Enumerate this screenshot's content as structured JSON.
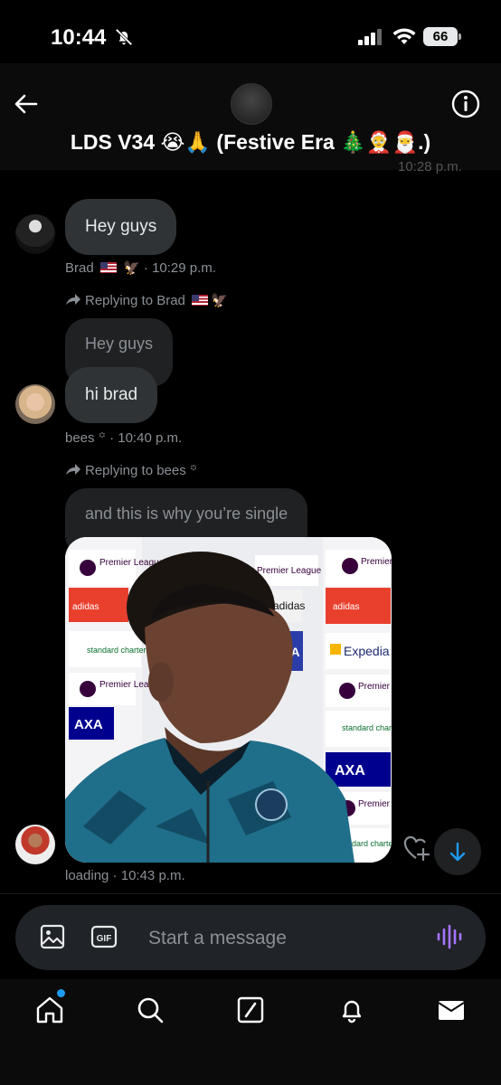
{
  "status_bar": {
    "time": "10:44",
    "battery": "66"
  },
  "header": {
    "title": "LDS V34 😭🙏 (Festive Era 🎄🤶🎅.)",
    "previous_timestamp": "10:28 p.m."
  },
  "messages": [
    {
      "text": "Hey guys",
      "sender": "Brad",
      "time": "10:29 p.m."
    },
    {
      "reply_to": "Replying to Brad",
      "quoted_text": "Hey guys",
      "text": "hi brad",
      "sender": "bees ꙳",
      "time": "10:40 p.m."
    },
    {
      "reply_to": "Replying to bees ꙳",
      "quoted_text": "and this is why you’re single",
      "media": "video-thumbnail",
      "sender": "loading",
      "time": "10:43 p.m."
    }
  ],
  "media_board": {
    "left_column": [
      "Premier League",
      "adidas",
      "standard chartered",
      "Premier League",
      "AXA"
    ],
    "center_column": [
      "Premier League",
      "adidas",
      "AXA"
    ],
    "right_column": [
      "Premier League",
      "adidas",
      "Expedia",
      "Premier League",
      "standard chartered",
      "AXA",
      "Premier League",
      "standard chartered"
    ]
  },
  "composer": {
    "placeholder": "Start a message"
  },
  "nav": {
    "items": [
      "home-icon",
      "search-icon",
      "grok-icon",
      "notifications-icon",
      "messages-icon"
    ]
  },
  "colors": {
    "accent": "#1d9bf0",
    "bubble": "#2f3336",
    "composer": "#202327",
    "voice": "#a574ff"
  }
}
